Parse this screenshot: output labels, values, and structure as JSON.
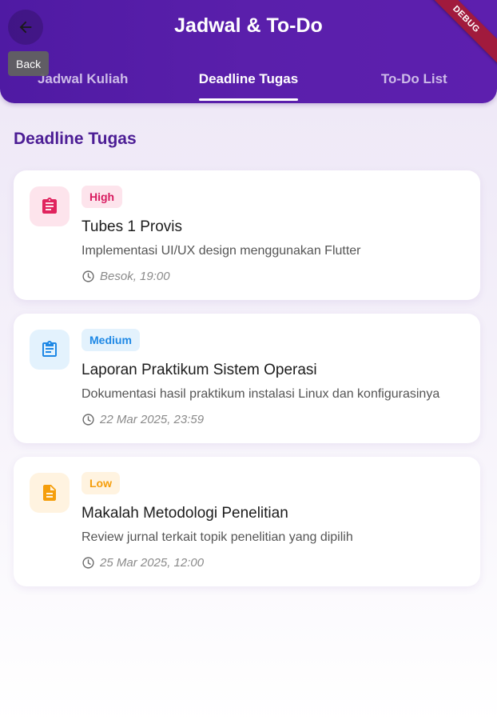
{
  "app": {
    "title": "Jadwal & To-Do",
    "back_tooltip": "Back",
    "debug_label": "DEBUG"
  },
  "tabs": [
    {
      "label": "Jadwal Kuliah",
      "active": false
    },
    {
      "label": "Deadline Tugas",
      "active": true
    },
    {
      "label": "To-Do List",
      "active": false
    }
  ],
  "section": {
    "heading": "Deadline Tugas"
  },
  "tasks": [
    {
      "priority": "High",
      "title": "Tubes 1 Provis",
      "description": "Implementasi UI/UX design menggunakan Flutter",
      "due": "Besok, 19:00",
      "icon": "assignment-icon",
      "accent": "#e0245e",
      "badge_bg": "#fde4ec",
      "icon_bg": "#fde4ec"
    },
    {
      "priority": "Medium",
      "title": "Laporan Praktikum Sistem Operasi",
      "description": "Dokumentasi hasil praktikum instalasi Linux dan konfigurasinya",
      "due": "22 Mar 2025, 23:59",
      "icon": "assignment-outline-icon",
      "accent": "#1e88e5",
      "badge_bg": "#e3f2fd",
      "icon_bg": "#e3f2fd"
    },
    {
      "priority": "Low",
      "title": "Makalah Metodologi Penelitian",
      "description": "Review jurnal terkait topik penelitian yang dipilih",
      "due": "25 Mar 2025, 12:00",
      "icon": "description-icon",
      "accent": "#f59e0b",
      "badge_bg": "#fff3e0",
      "icon_bg": "#fff3e0"
    }
  ]
}
